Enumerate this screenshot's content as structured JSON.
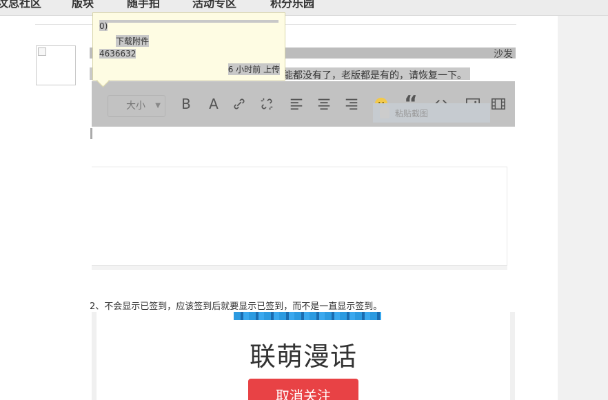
{
  "topnav": {
    "items": [
      "汶总社区",
      "版块",
      "随手拍",
      "活动专区",
      "积分乐园"
    ]
  },
  "post": {
    "floor_label": "沙发",
    "snippet": "能都没有了，老版都是有的，请恢复一下。"
  },
  "tooltip": {
    "paren_text": "0)",
    "download_label": "下载附件",
    "file_size": "4636632",
    "upload_time": "6 小时前 上传"
  },
  "toolbar": {
    "size_select": {
      "value": "大小"
    },
    "buttons": [
      {
        "name": "bold-icon"
      },
      {
        "name": "font-color-icon"
      },
      {
        "name": "link-icon"
      },
      {
        "name": "unlink-icon"
      },
      {
        "name": "align-left-icon"
      },
      {
        "name": "align-center-icon"
      },
      {
        "name": "align-right-icon"
      },
      {
        "name": "emoji-icon"
      },
      {
        "name": "quote-icon"
      },
      {
        "name": "code-icon"
      },
      {
        "name": "image-icon"
      },
      {
        "name": "video-icon"
      }
    ],
    "screenshot_hint": "粘贴截图"
  },
  "content": {
    "note2": "2、不会显示已签到，应该签到后就要显示已签到，而不是一直显示签到。",
    "screenshot": {
      "title": "联萌漫话",
      "button_label": "取消关注"
    }
  },
  "colors": {
    "tooltip_bg": "#fefce3",
    "cta_red": "#e84245",
    "toolbar_gray": "#c2c2c2"
  }
}
